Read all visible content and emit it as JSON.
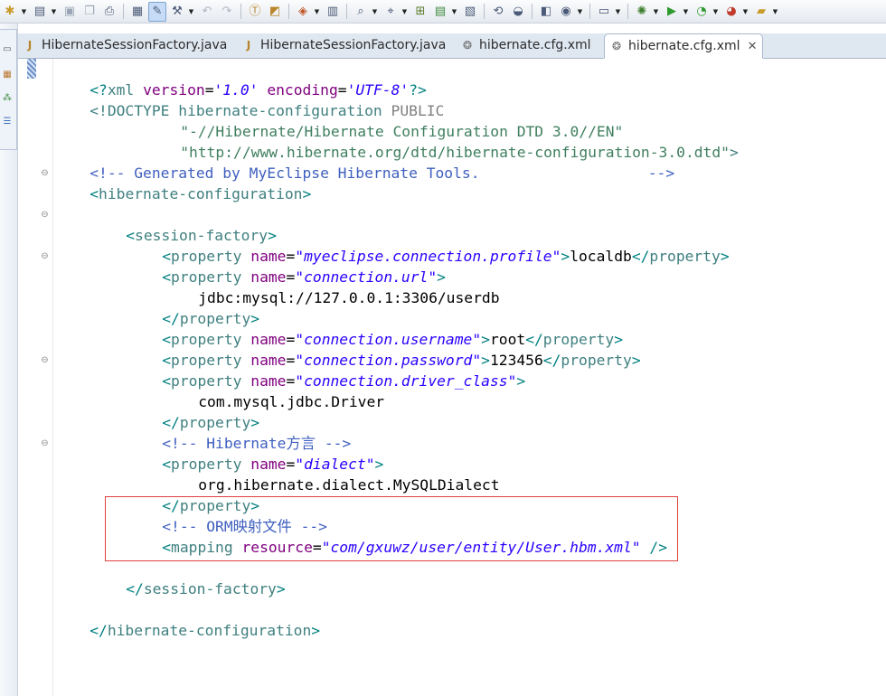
{
  "toolbar": {
    "icons": [
      "new-icon",
      "new-wizard-icon",
      "save-icon",
      "save-all-icon",
      "print-icon",
      "debug-config-icon",
      "highlight-icon",
      "build-icon",
      "back-icon",
      "forward-icon",
      "open-type-icon",
      "open-resource-icon",
      "new-project-icon",
      "browser-icon",
      "search-icon",
      "search-file-icon",
      "ant-icon",
      "run-config-icon",
      "deploy-icon",
      "refresh-icon",
      "server-icon",
      "publish-icon",
      "remote-icon",
      "screen-icon",
      "debug-icon",
      "run-icon",
      "coverage-icon",
      "external-tools-icon"
    ]
  },
  "tabs": [
    {
      "label": "HibernateSessionFactory.java",
      "icon": "java-file-icon",
      "active": false
    },
    {
      "label": "HibernateSessionFactory.java",
      "icon": "java-file-icon",
      "active": false
    },
    {
      "label": "hibernate.cfg.xml",
      "icon": "hibernate-config-icon",
      "active": false
    },
    {
      "label": "hibernate.cfg.xml",
      "icon": "hibernate-config-icon",
      "active": true,
      "close": "✕"
    }
  ],
  "code": {
    "l1": {
      "open": "<?",
      "name": "xml",
      "a1": "version",
      "eq1": "=",
      "v1": "'1.0'",
      "a2": "encoding",
      "eq2": "=",
      "v2": "'UTF-8'",
      "close": "?>"
    },
    "l2": {
      "open": "<!",
      "kw": "DOCTYPE",
      "name": "hibernate-configuration",
      "pub": "PUBLIC"
    },
    "l3": "\"-//Hibernate/Hibernate Configuration DTD 3.0//EN\"",
    "l4": "\"http://www.hibernate.org/dtd/hibernate-configuration-3.0.dtd\"",
    "l4_close": ">",
    "l5": "<!-- Generated by MyEclipse Hibernate Tools.                   -->",
    "l6": "hibernate-configuration",
    "l8": "session-factory",
    "l9": {
      "tag": "property",
      "attr": "name",
      "val": "\"myeclipse.connection.profile\"",
      "text": "localdb"
    },
    "l10": {
      "tag": "property",
      "attr": "name",
      "val": "\"connection.url\""
    },
    "l11": "jdbc:mysql://127.0.0.1:3306/userdb",
    "l12": "property",
    "l13": {
      "tag": "property",
      "attr": "name",
      "val": "\"connection.username\"",
      "text": "root"
    },
    "l14": {
      "tag": "property",
      "attr": "name",
      "val": "\"connection.password\"",
      "text": "123456"
    },
    "l15": {
      "tag": "property",
      "attr": "name",
      "val": "\"connection.driver_class\""
    },
    "l16": "com.mysql.jdbc.Driver",
    "l17": "property",
    "l18": "<!-- Hibernate方言 -->",
    "l19": {
      "tag": "property",
      "attr": "name",
      "val": "\"dialect\""
    },
    "l20": "org.hibernate.dialect.MySQLDialect",
    "l21": "property",
    "l22": "<!-- ORM映射文件 -->",
    "l23": {
      "tag": "mapping",
      "attr": "resource",
      "val": "\"com/gxuwz/user/entity/User.hbm.xml\""
    },
    "l25": "session-factory",
    "l27": "hibernate-configuration"
  },
  "colors": {
    "tag": "#3f7f7f",
    "attribute": "#7f007f",
    "value": "#2a00ff",
    "comment": "#3f5fbf",
    "highlight_box": "#e04040"
  }
}
